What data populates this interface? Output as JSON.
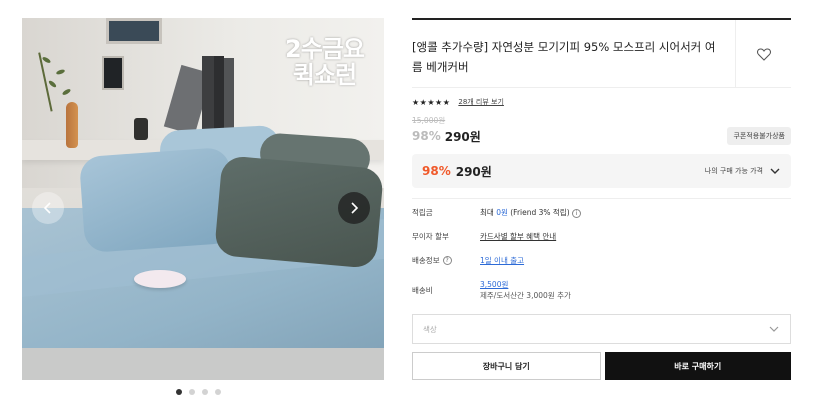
{
  "gallery": {
    "stamp_line1": "2수금요",
    "stamp_line2": "퀵쇼런",
    "prev_icon": "chevron-left-icon",
    "next_icon": "chevron-right-icon",
    "dots": 4,
    "active_dot": 0
  },
  "product": {
    "title": "[앵콜 추가수량] 자연성분 모기기피 95% 모스프리 시어서커 여름 베개커버",
    "wish_icon": "heart-icon",
    "stars": "★★★★★",
    "review_link": "28개 리뷰 보기",
    "original_price": "15,000원",
    "discount_rate": "98%",
    "sale_price": "290원",
    "coupon_badge": "쿠폰적용불가상품",
    "my_price": {
      "rate": "98%",
      "amount": "290원",
      "label": "나의 구매 가능 가격"
    }
  },
  "details": {
    "points_label": "적립금",
    "points_prefix": "최대 ",
    "points_value": "0원",
    "points_suffix": " (Friend 3% 적립)",
    "installment_label": "무이자 할부",
    "installment_value": "카드사별 할부 혜택 안내",
    "shipping_info_label": "배송정보",
    "shipping_info_value": "1일 이내 출고",
    "shipping_fee_label": "배송비",
    "shipping_fee_value": "3,500원",
    "shipping_fee_sub": "제주/도서산간 3,000원 추가"
  },
  "options": {
    "color_placeholder": "색상"
  },
  "buttons": {
    "cart": "장바구니 담기",
    "buy": "바로 구매하기"
  },
  "colors": {
    "accent_discount": "#f0592a",
    "link_blue": "#2d6bd7",
    "buy_button": "#111111"
  }
}
